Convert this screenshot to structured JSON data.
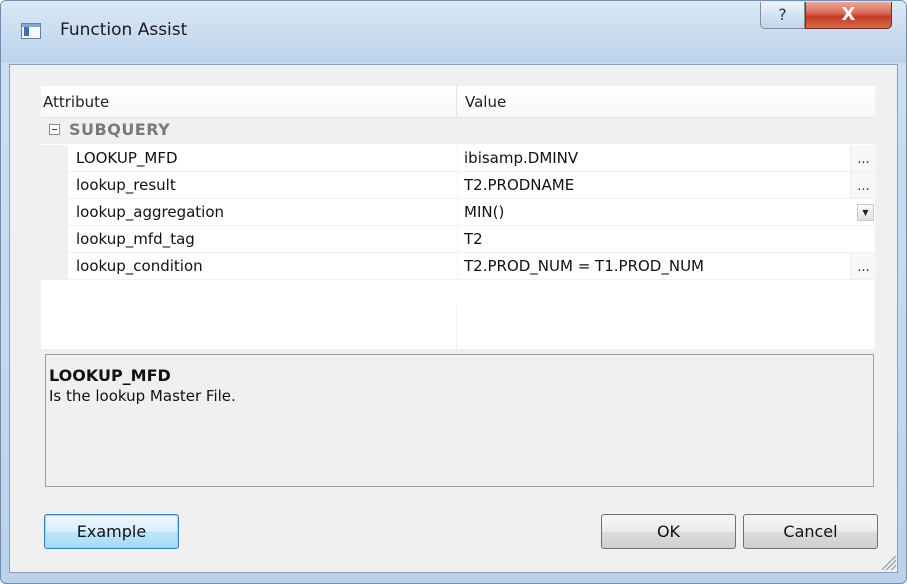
{
  "window": {
    "title": "Function Assist",
    "help_glyph": "?",
    "close_glyph": "X"
  },
  "grid": {
    "columns": [
      "Attribute",
      "Value"
    ],
    "group": {
      "label": "SUBQUERY",
      "expanded": true
    },
    "rows": [
      {
        "name": "LOOKUP_MFD",
        "value": "ibisamp.DMINV",
        "editor": "ellipsis"
      },
      {
        "name": "lookup_result",
        "value": "T2.PRODNAME",
        "editor": "ellipsis"
      },
      {
        "name": "lookup_aggregation",
        "value": "MIN()",
        "editor": "dropdown"
      },
      {
        "name": "lookup_mfd_tag",
        "value": "T2",
        "editor": "none"
      },
      {
        "name": "lookup_condition",
        "value": "T2.PROD_NUM = T1.PROD_NUM",
        "editor": "ellipsis"
      }
    ],
    "ellipsis_glyph": "...",
    "dropdown_glyph": "▼"
  },
  "description": {
    "title": "LOOKUP_MFD",
    "text": "Is the lookup Master File."
  },
  "buttons": {
    "example": "Example",
    "ok": "OK",
    "cancel": "Cancel"
  },
  "colors": {
    "title_bar": "#c9dcf0",
    "close_button": "#c23b26",
    "dialog_bg": "#f0f0f0",
    "grid_bg": "#ffffff",
    "group_label": "#7a7a7a",
    "focused_button_border": "#3c7fb1"
  },
  "icons": {
    "app": "window-app-icon",
    "help": "help-icon",
    "close": "close-icon",
    "collapse": "collapse-minus-icon",
    "resize": "resize-grip-icon"
  }
}
